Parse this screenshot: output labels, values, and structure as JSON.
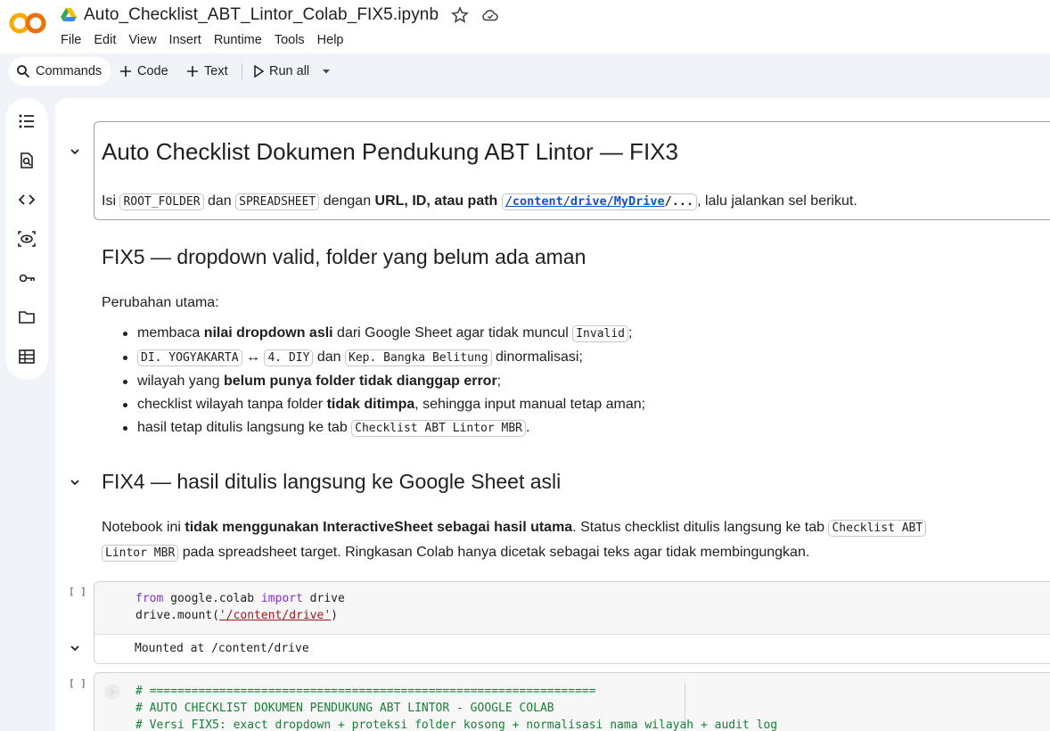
{
  "app": {
    "title": "Auto_Checklist_ABT_Lintor_Colab_FIX5.ipynb",
    "menu": [
      "File",
      "Edit",
      "View",
      "Insert",
      "Runtime",
      "Tools",
      "Help"
    ]
  },
  "toolbar": {
    "commands": "Commands",
    "code": "Code",
    "text": "Text",
    "run_all": "Run all"
  },
  "rail": {
    "icons": [
      "table-of-contents-icon",
      "find-icon",
      "code-snippets-icon",
      "variables-icon",
      "secrets-key-icon",
      "files-folder-icon",
      "data-table-icon"
    ]
  },
  "cell1": {
    "heading": "Auto Checklist Dokumen Pendukung ABT Lintor — FIX3",
    "p_isi": "Isi",
    "root_folder": "ROOT_FOLDER",
    "p_dan": "dan",
    "spreadsheet": "SPREADSHEET",
    "p_dengan": "dengan",
    "p_bold": "URL, ID, atau path",
    "path_link": "/content/drive/MyDrive",
    "path_rest": "/...",
    "p_end": ", lalu jalankan sel berikut."
  },
  "cell2": {
    "heading": "FIX5 — dropdown valid, folder yang belum ada aman",
    "intro": "Perubahan utama:",
    "b1_pre": "membaca ",
    "b1_bold": "nilai dropdown asli",
    "b1_mid": " dari Google Sheet agar tidak muncul ",
    "b1_code": "Invalid",
    "b1_end": ";",
    "b2_code1": "DI. YOGYAKARTA",
    "b2_arrow": " ↔ ",
    "b2_code2": "4. DIY",
    "b2_mid": " dan ",
    "b2_code3": "Kep. Bangka Belitung",
    "b2_end": " dinormalisasi;",
    "b3_pre": "wilayah yang ",
    "b3_bold": "belum punya folder tidak dianggap error",
    "b3_end": ";",
    "b4_pre": "checklist wilayah tanpa folder ",
    "b4_bold": "tidak ditimpa",
    "b4_end": ", sehingga input manual tetap aman;",
    "b5_pre": "hasil tetap ditulis langsung ke tab ",
    "b5_code": "Checklist ABT Lintor MBR",
    "b5_end": "."
  },
  "cell3": {
    "heading": "FIX4 — hasil ditulis langsung ke Google Sheet asli",
    "p_pre": "Notebook ini ",
    "p_bold": "tidak menggunakan InteractiveSheet sebagai hasil utama",
    "p_mid": ". Status checklist ditulis langsung ke tab ",
    "p_code1": "Checklist ABT",
    "p_code2": "Lintor MBR",
    "p_end": " pada spreadsheet target. Ringkasan Colab hanya dicetak sebagai teks agar tidak membingungkan."
  },
  "code_cell_1": {
    "exec_count": "[ ]",
    "kw_from": "from",
    "mod": " google.colab ",
    "kw_import": "import",
    "name": " drive",
    "line2_pre": "drive.mount(",
    "line2_str": "'/content/drive'",
    "line2_end": ")",
    "output": "Mounted at /content/drive"
  },
  "code_cell_2": {
    "exec_count": "[ ]",
    "line1": "# ================================================================",
    "line2": "# AUTO CHECKLIST DOKUMEN PENDUKUNG ABT LINTOR - GOOGLE COLAB",
    "line3": "# Versi FIX5: exact dropdown + proteksi folder kosong + normalisasi nama wilayah + audit log"
  }
}
